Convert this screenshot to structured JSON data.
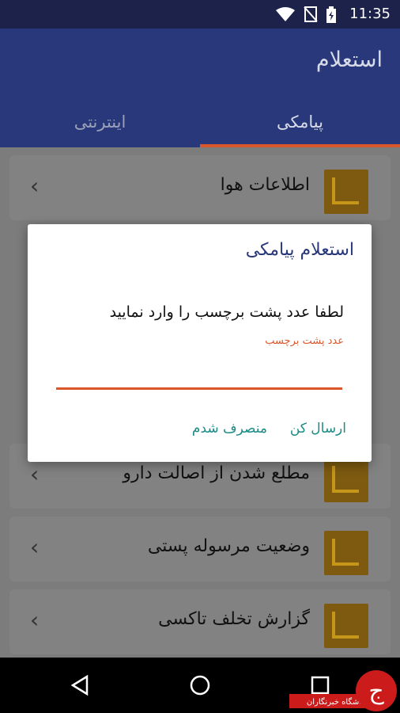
{
  "status": {
    "time": "11:35"
  },
  "app": {
    "title": "استعلام"
  },
  "tabs": [
    {
      "label": "پیامکی",
      "selected": true
    },
    {
      "label": "اینترنتی",
      "selected": false
    }
  ],
  "list": [
    {
      "label": "اطلاعات هوا"
    },
    {
      "label": "مطلع شدن از اصالت دارو"
    },
    {
      "label": "وضعیت مرسوله پستی"
    },
    {
      "label": "گزارش تخلف تاکسی"
    }
  ],
  "dialog": {
    "title": "استعلام پیامکی",
    "message": "لطفا عدد پشت برچسب را وارد نمایید",
    "field_hint": "عدد پشت برچسب",
    "field_value": "",
    "send_label": "ارسال کن",
    "cancel_label": "منصرف شدم"
  },
  "watermark": {
    "text": "باشگاه خبرنگاران"
  },
  "colors": {
    "toolbar": "#28387a",
    "status_bar": "#1c2249",
    "accent": "#d9572b",
    "button_text": "#1a8b85",
    "thumb": "#c69618"
  }
}
